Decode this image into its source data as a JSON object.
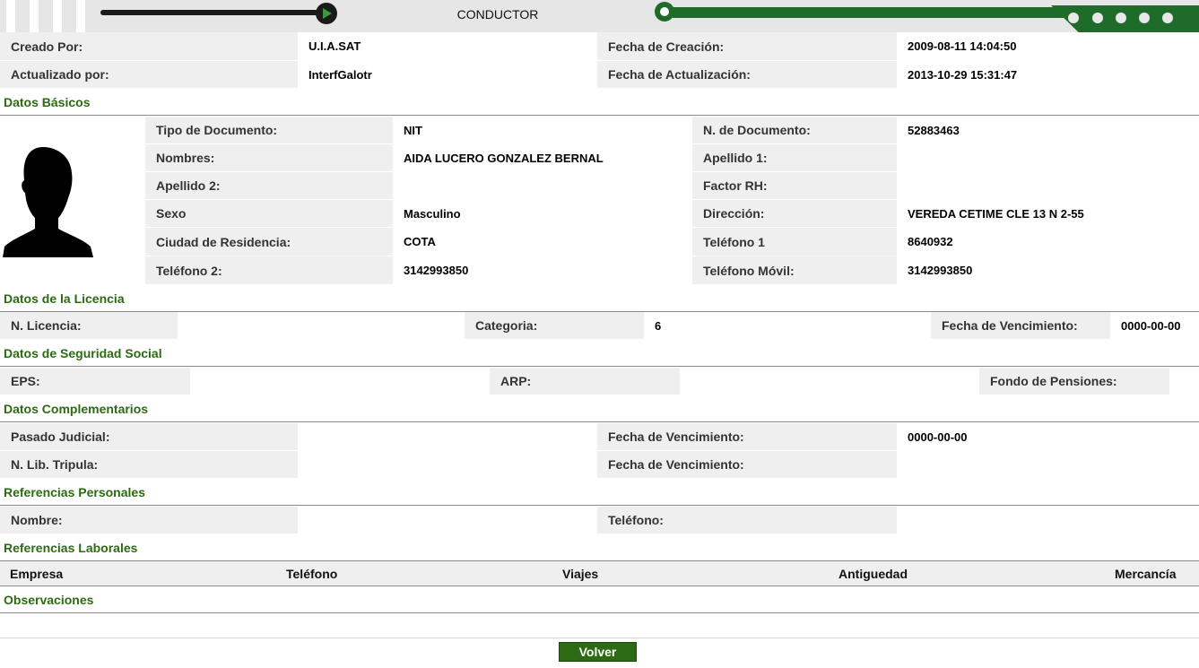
{
  "header": {
    "title": "CONDUCTOR"
  },
  "audit": {
    "created_by_label": "Creado Por:",
    "created_by": "U.I.A.SAT",
    "created_date_label": "Fecha de Creación:",
    "created_date": "2009-08-11 14:04:50",
    "updated_by_label": "Actualizado por:",
    "updated_by": "InterfGalotr",
    "updated_date_label": "Fecha de Actualización:",
    "updated_date": "2013-10-29 15:31:47"
  },
  "basic": {
    "section_title": "Datos Básicos",
    "doc_type_label": "Tipo de Documento:",
    "doc_type": "NIT",
    "doc_number_label": "N. de Documento:",
    "doc_number": "52883463",
    "names_label": "Nombres:",
    "names": "AIDA LUCERO GONZALEZ BERNAL",
    "surname1_label": "Apellido 1:",
    "surname1": "",
    "surname2_label": "Apellido 2:",
    "surname2": "",
    "rh_label": "Factor RH:",
    "rh": "",
    "sex_label": "Sexo",
    "sex": "Masculino",
    "address_label": "Dirección:",
    "address": "VEREDA CETIME CLE 13 N 2-55",
    "city_label": "Ciudad de Residencia:",
    "city": "COTA",
    "phone1_label": "Teléfono 1",
    "phone1": "8640932",
    "phone2_label": "Teléfono 2:",
    "phone2": "3142993850",
    "mobile_label": "Teléfono Móvil:",
    "mobile": "3142993850"
  },
  "license": {
    "section_title": "Datos de la Licencia",
    "number_label": "N. Licencia:",
    "number": "",
    "category_label": "Categoria:",
    "category": "6",
    "expiry_label": "Fecha de Vencimiento:",
    "expiry": "0000-00-00"
  },
  "social": {
    "section_title": "Datos de Seguridad Social",
    "eps_label": "EPS:",
    "eps": "",
    "arp_label": "ARP:",
    "arp": "",
    "pension_label": "Fondo de Pensiones:",
    "pension": ""
  },
  "complementary": {
    "section_title": "Datos Complementarios",
    "judicial_label": "Pasado Judicial:",
    "judicial": "",
    "judicial_expiry_label": "Fecha de Vencimiento:",
    "judicial_expiry": "0000-00-00",
    "crew_book_label": "N. Lib. Tripula:",
    "crew_book": "",
    "crew_expiry_label": "Fecha de Vencimiento:",
    "crew_expiry": ""
  },
  "personal_refs": {
    "section_title": "Referencias Personales",
    "name_label": "Nombre:",
    "name": "",
    "phone_label": "Teléfono:",
    "phone": ""
  },
  "work_refs": {
    "section_title": "Referencias Laborales",
    "columns": [
      "Empresa",
      "Teléfono",
      "Viajes",
      "Antiguedad",
      "Mercancía"
    ]
  },
  "observations": {
    "section_title": "Observaciones"
  },
  "actions": {
    "back_label": "Volver"
  },
  "colors": {
    "section_green": "#2d6a14",
    "label_bg": "#efefef",
    "button_green": "#2d6a14"
  }
}
